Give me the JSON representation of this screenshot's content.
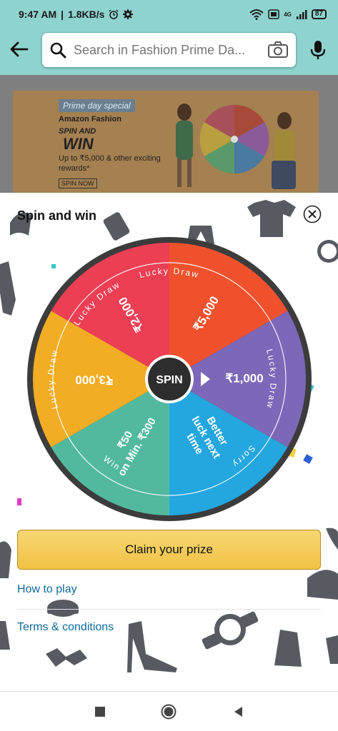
{
  "status_bar": {
    "time": "9:47 AM",
    "separator": "|",
    "net_speed": "1.8KB/s",
    "battery": "87",
    "icons": [
      "alarm-icon",
      "gear-icon",
      "wifi-icon",
      "volte-icon",
      "signal-icon"
    ],
    "network_badge": "4G"
  },
  "header": {
    "search_placeholder": "Search in Fashion Prime Da...",
    "icons": [
      "back-arrow-icon",
      "search-icon",
      "camera-icon",
      "mic-icon"
    ]
  },
  "banner": {
    "tag": "Prime day special",
    "brand": "Amazon Fashion",
    "line1": "SPIN AND",
    "line2": "WIN",
    "rewards": "Up to ₹5,000 & other exciting rewards*",
    "cta": "SPIN NOW"
  },
  "sheet": {
    "title": "Spin and win",
    "close_icon": "close-icon",
    "center_label": "SPIN",
    "segments": [
      {
        "label": "₹5,000",
        "color": "#f0512d"
      },
      {
        "label": "₹1,000",
        "color": "#7d67b8"
      },
      {
        "label": "Better luck next time",
        "color": "#24a6de"
      },
      {
        "label": "₹50 on Min. ₹300",
        "color": "#52b99e"
      },
      {
        "label": "₹3,000",
        "color": "#f2ad24"
      },
      {
        "label": "₹2,000",
        "color": "#ec3f54"
      }
    ],
    "arc_labels": [
      "Lucky Draw",
      "Lucky Draw",
      "Sorry",
      "Win",
      "Lucky Draw",
      "Lucky Draw"
    ],
    "claim_button": "Claim your prize",
    "how_to_play": "How to play",
    "terms": "Terms & conditions"
  },
  "nav_bar": {
    "icons": [
      "recents-square-icon",
      "home-circle-icon",
      "back-triangle-icon"
    ]
  },
  "colors": {
    "header_bg": "#8fd3cf",
    "wheel_rim": "#3c3c3c",
    "claim_button": "#f1c244",
    "link": "#0f6b9a"
  }
}
